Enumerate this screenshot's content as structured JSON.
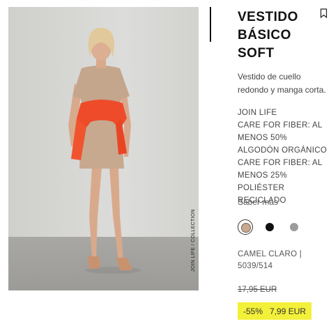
{
  "product": {
    "title_lines": [
      "VESTIDO",
      "BÁSICO",
      "SOFT"
    ],
    "description": "Vestido de cuello redondo y manga corta.",
    "composition": [
      "JOIN LIFE",
      "CARE FOR FIBER: AL MENOS 50% ALGODÓN ORGÁNICO",
      "CARE FOR FIBER: AL MENOS 25% POLIÉSTER RECICLADO"
    ],
    "more_link": "Saber más",
    "color_info": "CAMEL CLARO | 5039/514",
    "original_price": "17,95 EUR",
    "discount": "-55%",
    "sale_price": "7,99 EUR"
  },
  "image": {
    "collection_label": "JOIN LIFE / COLLECTION"
  },
  "colors": [
    {
      "name": "camel-claro",
      "hex": "#c8a88e",
      "selected": true
    },
    {
      "name": "black",
      "hex": "#111111",
      "selected": false
    },
    {
      "name": "grey",
      "hex": "#9c9c9c",
      "selected": false
    }
  ],
  "accent": {
    "price_highlight": "#f3f03a"
  }
}
